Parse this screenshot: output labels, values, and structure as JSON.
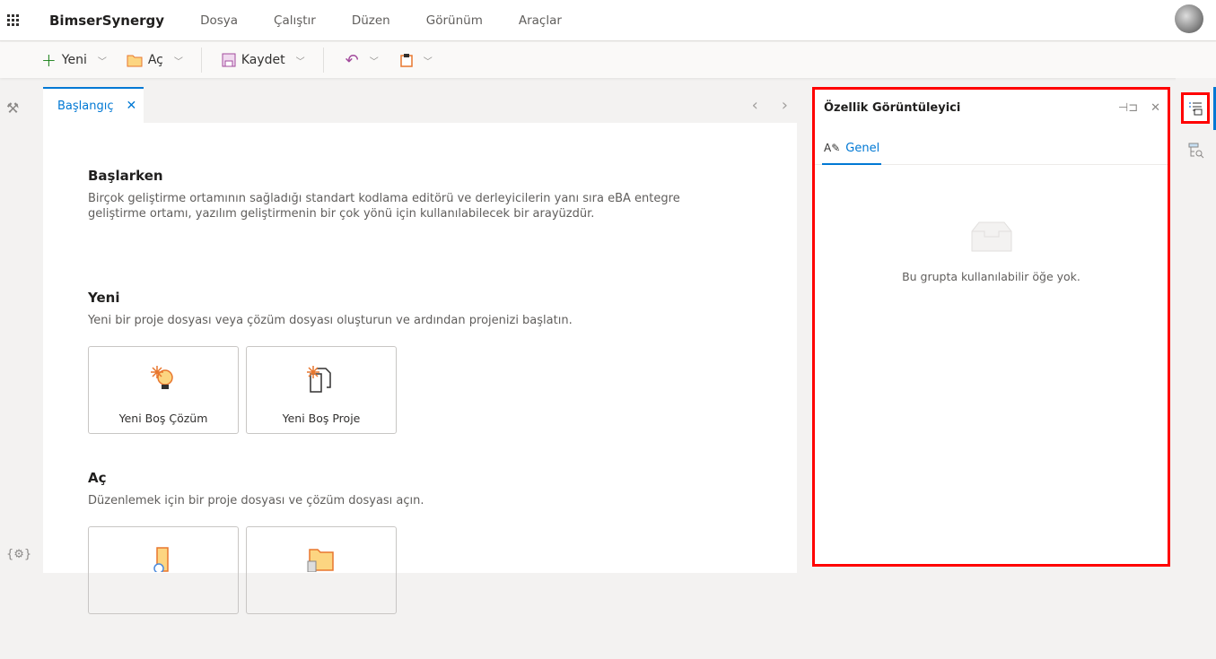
{
  "header": {
    "brand": "BimserSynergy",
    "menu": [
      "Dosya",
      "Çalıştır",
      "Düzen",
      "Görünüm",
      "Araçlar"
    ]
  },
  "toolbar": {
    "new": "Yeni",
    "open": "Aç",
    "save": "Kaydet"
  },
  "tabs": [
    {
      "label": "Başlangıç"
    }
  ],
  "start": {
    "intro_title": "Başlarken",
    "intro_desc": "Birçok geliştirme ortamının sağladığı standart kodlama editörü ve derleyicilerin yanı sıra eBA entegre geliştirme ortamı, yazılım geliştirmenin bir çok yönü için kullanılabilecek bir arayüzdür.",
    "new_title": "Yeni",
    "new_desc": "Yeni bir proje dosyası veya çözüm dosyası oluşturun ve ardından projenizi başlatın.",
    "new_cards": [
      "Yeni Boş Çözüm",
      "Yeni Boş Proje"
    ],
    "open_title": "Aç",
    "open_desc": "Düzenlemek için bir proje dosyası ve çözüm dosyası açın."
  },
  "property_panel": {
    "title": "Özellik Görüntüleyici",
    "tab": "Genel",
    "empty": "Bu grupta kullanılabilir öğe yok."
  }
}
